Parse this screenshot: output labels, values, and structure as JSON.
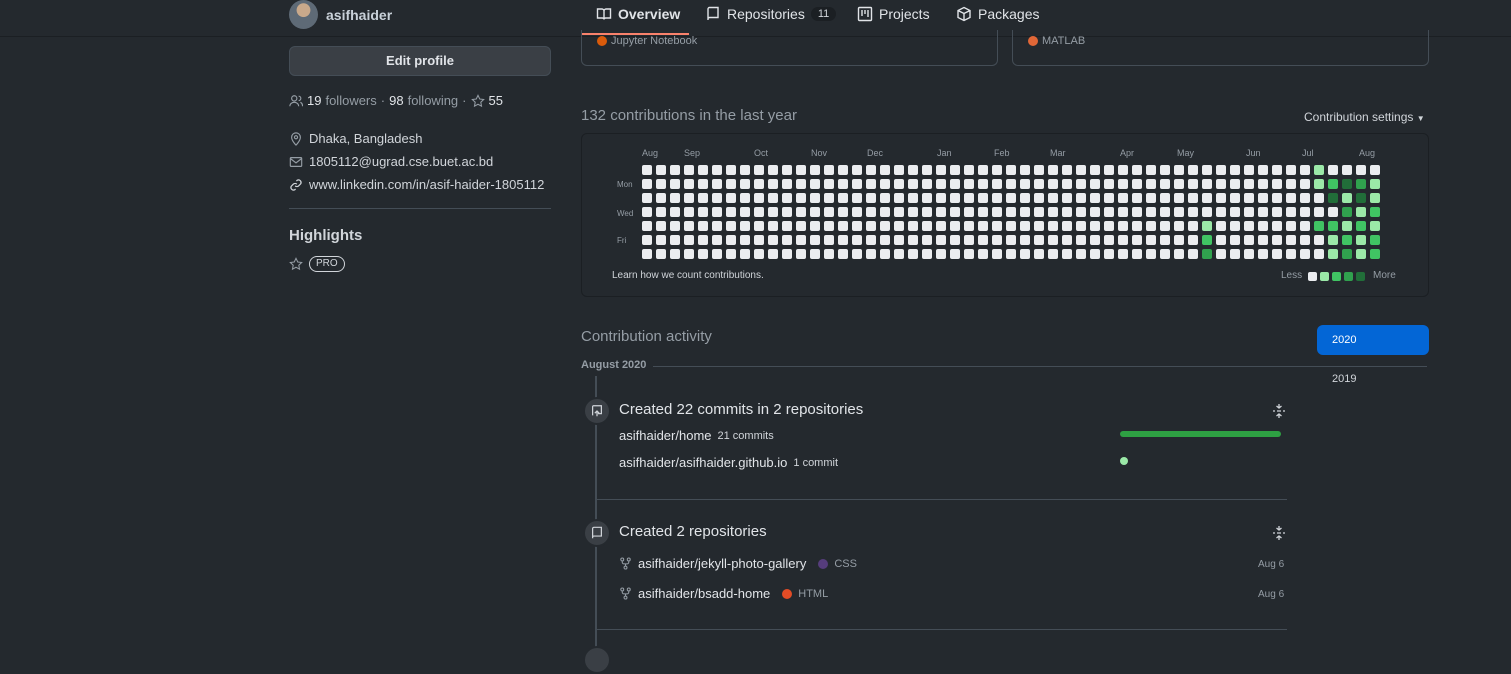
{
  "header": {
    "username": "asifhaider",
    "tabs": [
      {
        "label": "Overview",
        "icon": "book-icon",
        "active": true
      },
      {
        "label": "Repositories",
        "icon": "repo-icon",
        "count": "11"
      },
      {
        "label": "Projects",
        "icon": "project-icon"
      },
      {
        "label": "Packages",
        "icon": "package-icon"
      }
    ]
  },
  "profile": {
    "edit_label": "Edit profile",
    "followers_count": "19",
    "followers_label": "followers",
    "following_count": "98",
    "following_label": "following",
    "stars_count": "55",
    "location": "Dhaka, Bangladesh",
    "email": "1805112@ugrad.cse.buet.ac.bd",
    "website": "www.linkedin.com/in/asif-haider-1805112",
    "highlights_title": "Highlights",
    "pro_badge": "PRO"
  },
  "pinned_langs": [
    {
      "name": "Jupyter Notebook",
      "color": "#da5b0b"
    },
    {
      "name": "MATLAB",
      "color": "#e16737"
    }
  ],
  "contributions": {
    "title": "132 contributions in the last year",
    "settings_label": "Contribution settings",
    "months": [
      "Aug",
      "Sep",
      "Oct",
      "Nov",
      "Dec",
      "Jan",
      "Feb",
      "Mar",
      "Apr",
      "May",
      "Jun",
      "Jul",
      "Aug"
    ],
    "days": [
      "Mon",
      "Wed",
      "Fri"
    ],
    "learn_label": "Learn how we count contributions.",
    "less_label": "Less",
    "more_label": "More",
    "level_colors": [
      "#ebedf0",
      "#9be9a8",
      "#40c463",
      "#30a14e",
      "#216e39"
    ]
  },
  "activity": {
    "title": "Contribution activity",
    "month": "August 2020",
    "commits_heading": "Created 22 commits in 2 repositories",
    "commit_repos": [
      {
        "name": "asifhaider/home",
        "count": "21 commits",
        "share": 0.95
      },
      {
        "name": "asifhaider/asifhaider.github.io",
        "count": "1 commit",
        "share": 0.05
      }
    ],
    "repos_heading": "Created 2 repositories",
    "created_repos": [
      {
        "name": "asifhaider/jekyll-photo-gallery",
        "lang": "CSS",
        "lang_color": "#563d7c",
        "date": "Aug 6"
      },
      {
        "name": "asifhaider/bsadd-home",
        "lang": "HTML",
        "lang_color": "#e34c26",
        "date": "Aug 6"
      }
    ]
  },
  "years": [
    "2020",
    "2019"
  ]
}
